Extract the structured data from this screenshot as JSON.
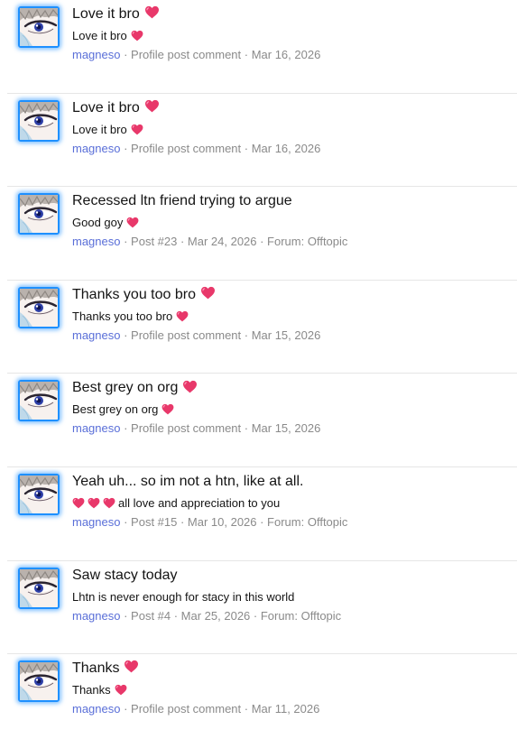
{
  "icons": {
    "avatar": "user-avatar-anime-eye",
    "heart": "pink-heart-emoji"
  },
  "colors": {
    "username": "#5a6fd8",
    "meta": "#8a8a8a",
    "avatar_border": "#1e90ff",
    "heart": "#e8386a"
  },
  "results": [
    {
      "title": "Love it bro",
      "snippet": "Love it bro",
      "user": "magneso",
      "meta": " · Profile post comment · Mar 16, 2026"
    },
    {
      "title": "Love it bro",
      "snippet": "Love it bro",
      "user": "magneso",
      "meta": " · Profile post comment · Mar 16, 2026"
    },
    {
      "title": "Recessed ltn friend trying to argue",
      "snippet": "Good goy",
      "user": "magneso",
      "meta": " · Post #23 · Mar 24, 2026 · Forum: Offtopic"
    },
    {
      "title": "Thanks you too bro",
      "snippet": "Thanks you too bro",
      "user": "magneso",
      "meta": " · Profile post comment · Mar 15, 2026"
    },
    {
      "title": "Best grey on org",
      "snippet": "Best grey on org",
      "user": "magneso",
      "meta": " · Profile post comment · Mar 15, 2026"
    },
    {
      "title": "Yeah uh... so im not a htn, like at all.",
      "snippet": "all love and appreciation to you",
      "user": "magneso",
      "meta": " · Post #15 · Mar 10, 2026 · Forum: Offtopic"
    },
    {
      "title": "Saw stacy today",
      "snippet": "Lhtn is never enough for stacy in this world",
      "user": "magneso",
      "meta": " · Post #4 · Mar 25, 2026 · Forum: Offtopic"
    },
    {
      "title": "Thanks",
      "snippet": "Thanks",
      "user": "magneso",
      "meta": " · Profile post comment · Mar 11, 2026"
    }
  ]
}
